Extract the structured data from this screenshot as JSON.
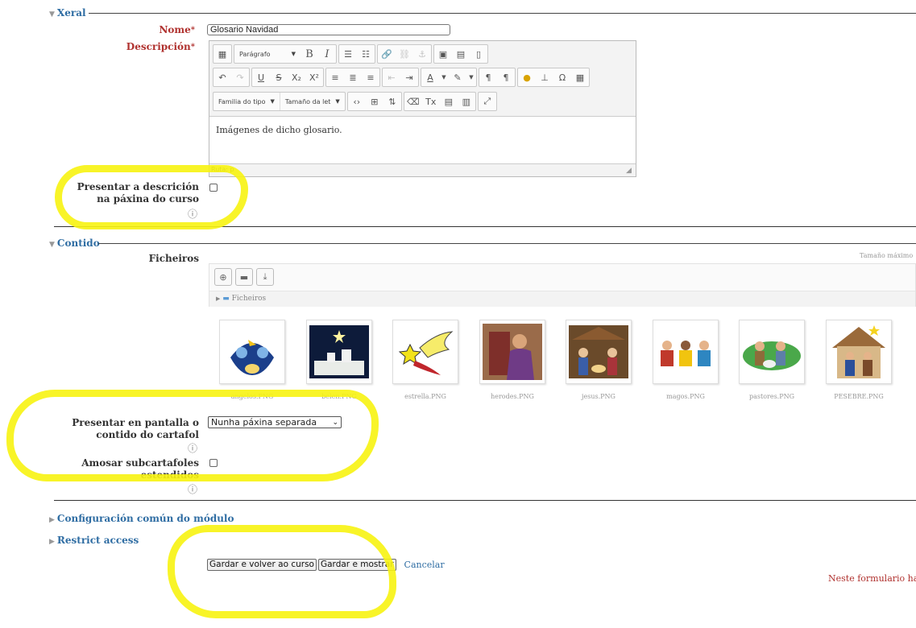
{
  "general": {
    "legend": "Xeral",
    "name_label": "Nome",
    "name_value": "Glosario Navidad",
    "description_label": "Descripción",
    "editor": {
      "paragraph_select": "Parágrafo",
      "font_family_select": "Familia do tipo",
      "font_size_select": "Tamaño da let",
      "content": "Imágenes de dicho glosario.",
      "path": "Ruta: p"
    },
    "show_description_label": "Presentar a descrición na páxina do curso"
  },
  "content": {
    "legend": "Contido",
    "files_label": "Ficheiros",
    "max_size_note": "Tamaño máximo",
    "folder_crumb": "Ficheiros",
    "files": [
      {
        "name": "angelos.PNG",
        "icon": "angels-image"
      },
      {
        "name": "belen.PNG",
        "icon": "bethlehem-image"
      },
      {
        "name": "estrella.PNG",
        "icon": "star-image"
      },
      {
        "name": "herodes.PNG",
        "icon": "herod-image"
      },
      {
        "name": "jesus.PNG",
        "icon": "nativity-image"
      },
      {
        "name": "magos.PNG",
        "icon": "wise-men-image"
      },
      {
        "name": "pastores.PNG",
        "icon": "shepherds-image"
      },
      {
        "name": "PESEBRE.PNG",
        "icon": "manger-image"
      }
    ],
    "display_label": "Presentar en pantalla o contido do cartafol",
    "display_value": "Nunha páxina separada",
    "expanded_label": "Amosar subcartafoles estendidos"
  },
  "sections": {
    "common_settings": "Configuración común do módulo",
    "restrict_access": "Restrict access"
  },
  "actions": {
    "save_return": "Gardar e volver ao curso",
    "save_display": "Gardar e mostrar",
    "cancel": "Cancelar"
  },
  "footer_note": "Neste formulario hai",
  "colors": {
    "highlight": "#f7f311",
    "legend": "#2f6da3",
    "required": "#b0322f"
  }
}
